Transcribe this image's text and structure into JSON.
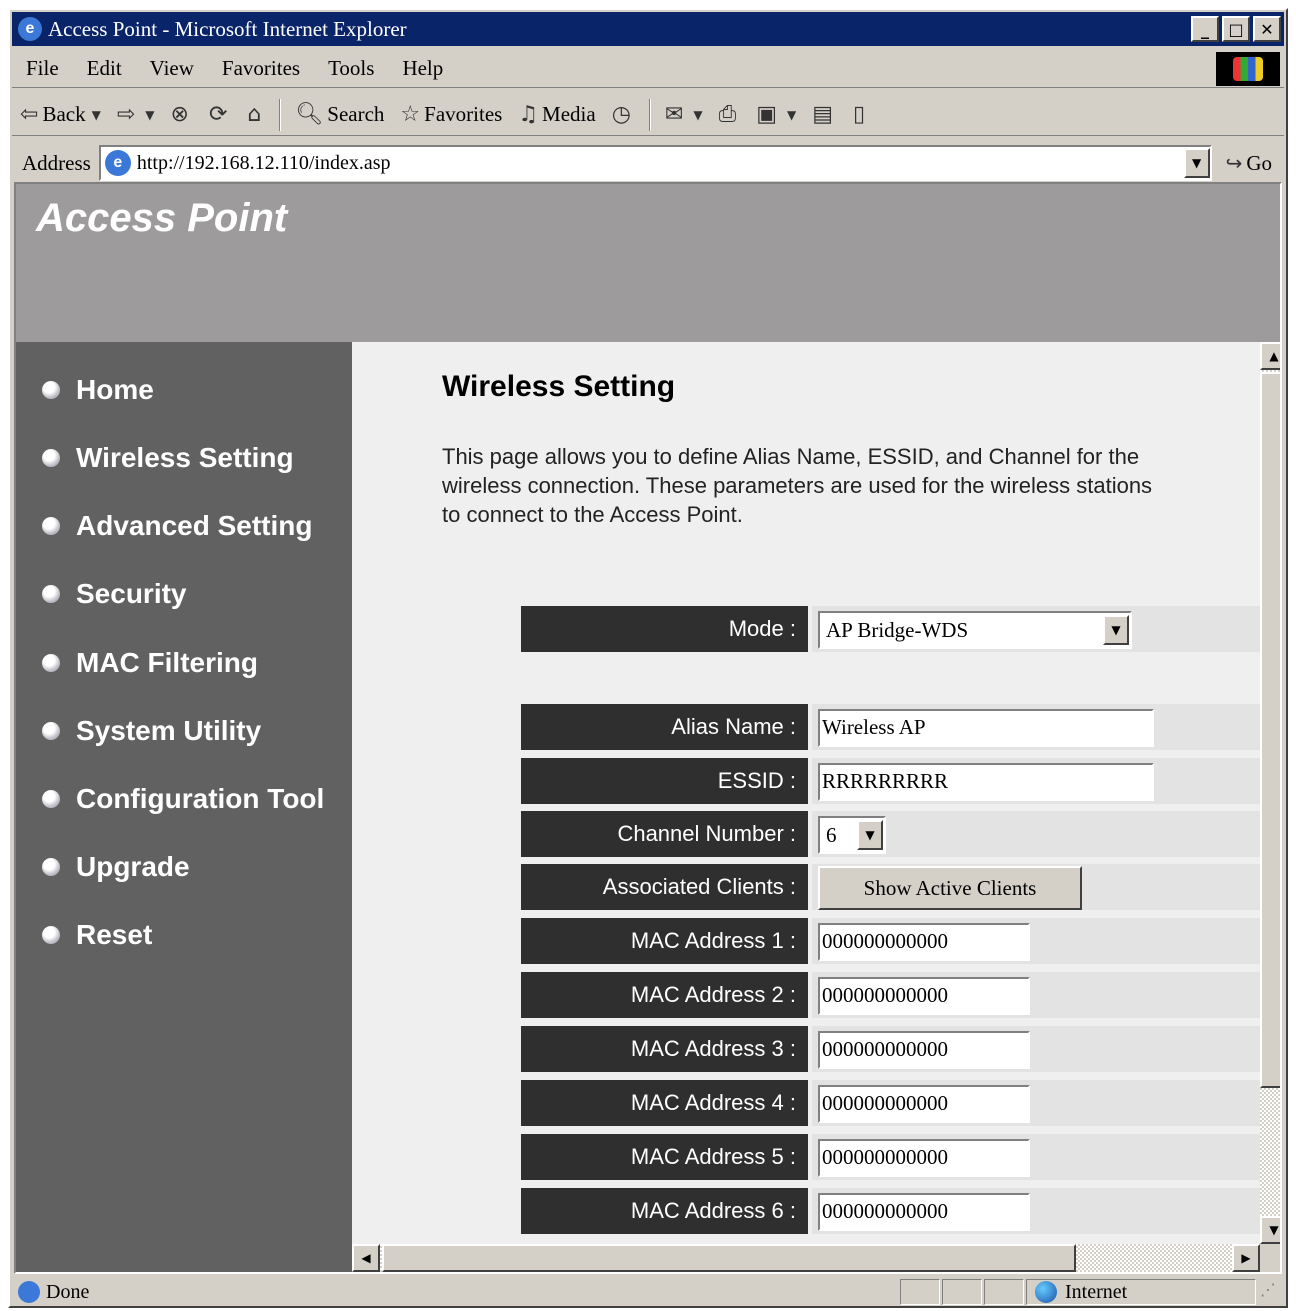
{
  "window": {
    "title": "Access Point - Microsoft Internet Explorer"
  },
  "menu": [
    "File",
    "Edit",
    "View",
    "Favorites",
    "Tools",
    "Help"
  ],
  "toolbar": {
    "back": "Back",
    "search": "Search",
    "favorites": "Favorites",
    "media": "Media"
  },
  "address": {
    "label": "Address",
    "url": "http://192.168.12.110/index.asp",
    "go": "Go"
  },
  "banner": {
    "title": "Access Point"
  },
  "nav": [
    "Home",
    "Wireless Setting",
    "Advanced Setting",
    "Security",
    "MAC Filtering",
    "System Utility",
    "Configuration Tool",
    "Upgrade",
    "Reset"
  ],
  "page": {
    "heading": "Wireless Setting",
    "description": "This page allows you to define Alias Name, ESSID, and Channel for the wireless connection. These parameters are used for the wireless stations to connect to the Access Point."
  },
  "form": {
    "mode": {
      "label": "Mode :",
      "value": "AP Bridge-WDS"
    },
    "alias": {
      "label": "Alias Name :",
      "value": "Wireless AP"
    },
    "essid": {
      "label": "ESSID :",
      "value": "RRRRRRRRR"
    },
    "channel": {
      "label": "Channel Number :",
      "value": "6"
    },
    "clients": {
      "label": "Associated Clients :",
      "button": "Show Active Clients"
    },
    "mac": [
      {
        "label": "MAC Address 1 :",
        "value": "000000000000"
      },
      {
        "label": "MAC Address 2 :",
        "value": "000000000000"
      },
      {
        "label": "MAC Address 3 :",
        "value": "000000000000"
      },
      {
        "label": "MAC Address 4 :",
        "value": "000000000000"
      },
      {
        "label": "MAC Address 5 :",
        "value": "000000000000"
      },
      {
        "label": "MAC Address 6 :",
        "value": "000000000000"
      }
    ]
  },
  "status": {
    "text": "Done",
    "zone": "Internet"
  },
  "colors": {
    "titlebar": "#0a246a",
    "banner": "#9d9b9c",
    "sidebar": "#616161",
    "content_bg": "#efefef",
    "label_bg": "#2f2f2f"
  },
  "icons": [
    "ie-icon",
    "minimize-icon",
    "maximize-icon",
    "close-icon",
    "windows-logo-icon",
    "back-arrow-icon",
    "forward-arrow-icon",
    "stop-icon",
    "refresh-icon",
    "home-icon",
    "search-icon",
    "favorites-icon",
    "media-icon",
    "history-icon",
    "mail-icon",
    "print-icon",
    "edit-icon",
    "discuss-icon",
    "messenger-icon",
    "go-arrow-icon",
    "globe-icon"
  ]
}
